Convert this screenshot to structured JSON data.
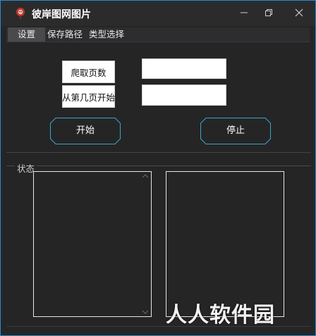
{
  "window": {
    "title": "彼岸图网图片"
  },
  "menu": {
    "items": [
      "设置",
      "保存路径",
      "类型选择"
    ]
  },
  "form": {
    "pages_label": "爬取页数",
    "start_page_label": "从第几页开始",
    "pages_value": "",
    "start_page_value": ""
  },
  "buttons": {
    "start": "开始",
    "stop": "停止"
  },
  "status": {
    "group_label": "状态"
  },
  "watermark": "人人软件园",
  "colors": {
    "window_border": "#1f8fd8",
    "button_border": "#3aa6c9",
    "background": "#252526"
  }
}
